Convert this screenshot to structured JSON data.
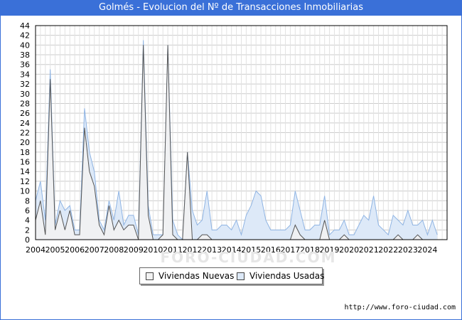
{
  "title": "Golmés - Evolucion del Nº de Transacciones Inmobiliarias",
  "credit": "http://www.foro-ciudad.com",
  "watermark": "FORO-CIUDAD.COM",
  "colors": {
    "title_bar": "#3a70d8",
    "nuevas_fill": "#f2f2f2",
    "nuevas_line": "#555555",
    "usadas_fill": "#dde9f8",
    "usadas_line": "#8fb4e3"
  },
  "chart_data": {
    "type": "area",
    "title": "Golmés - Evolucion del Nº de Transacciones Inmobiliarias",
    "x_unit": "quarter",
    "x_start": "2004-Q1",
    "year_labels": [
      "2004",
      "2005",
      "2006",
      "2007",
      "2008",
      "2009",
      "2010",
      "2011",
      "2012",
      "2013",
      "2014",
      "2015",
      "2016",
      "2017",
      "2018",
      "2019",
      "2020",
      "2021",
      "2022",
      "2023",
      "2024"
    ],
    "ylim": [
      0,
      44
    ],
    "yticks": [
      0,
      2,
      4,
      6,
      8,
      10,
      12,
      14,
      16,
      18,
      20,
      22,
      24,
      26,
      28,
      30,
      32,
      34,
      36,
      38,
      40,
      42,
      44
    ],
    "grid": true,
    "legend_position": "bottom",
    "series": [
      {
        "name": "Viviendas Nuevas",
        "values": [
          4,
          8,
          1,
          33,
          2,
          6,
          2,
          6,
          1,
          1,
          23,
          14,
          11,
          3,
          1,
          7,
          2,
          4,
          2,
          3,
          3,
          0,
          40,
          5,
          0,
          0,
          1,
          40,
          1,
          0,
          0,
          18,
          0,
          0,
          1,
          1,
          0,
          0,
          0,
          0,
          0,
          0,
          0,
          0,
          0,
          0,
          0,
          0,
          0,
          0,
          0,
          0,
          0,
          3,
          1,
          0,
          0,
          0,
          0,
          4,
          0,
          0,
          0,
          1,
          0,
          0,
          0,
          0,
          0,
          0,
          0,
          0,
          0,
          0,
          1,
          0,
          0,
          0,
          1,
          0,
          0,
          0
        ]
      },
      {
        "name": "Viviendas Usadas",
        "values": [
          8,
          12,
          4,
          35,
          3,
          8,
          6,
          7,
          2,
          2,
          27,
          18,
          14,
          4,
          2,
          8,
          4,
          10,
          3,
          5,
          5,
          1,
          41,
          7,
          1,
          1,
          1,
          40,
          4,
          1,
          0,
          18,
          6,
          3,
          4,
          10,
          2,
          2,
          3,
          3,
          2,
          4,
          1,
          5,
          7,
          10,
          9,
          4,
          2,
          2,
          2,
          2,
          3,
          10,
          6,
          2,
          2,
          3,
          3,
          9,
          1,
          2,
          2,
          4,
          1,
          1,
          3,
          5,
          4,
          9,
          3,
          2,
          1,
          5,
          4,
          3,
          6,
          3,
          3,
          4,
          1,
          4,
          1
        ]
      }
    ]
  }
}
